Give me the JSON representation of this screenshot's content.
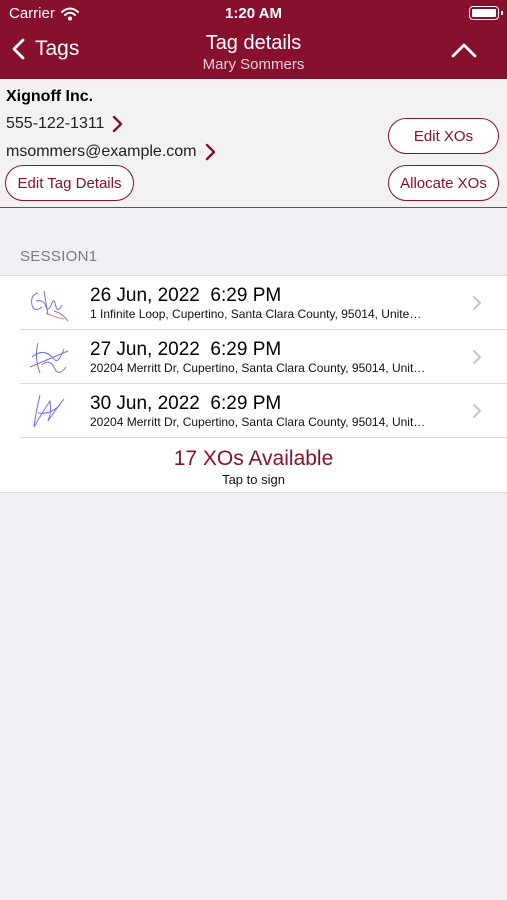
{
  "status_bar": {
    "carrier": "Carrier",
    "time": "1:20 AM"
  },
  "nav": {
    "back_label": "Tags",
    "title": "Tag details",
    "subtitle": "Mary Sommers"
  },
  "contact": {
    "company": "Xignoff Inc.",
    "phone": "555-122-1311",
    "email": "msommers@example.com"
  },
  "buttons": {
    "edit_tag_details": "Edit Tag Details",
    "edit_xos": "Edit XOs",
    "allocate_xos": "Allocate XOs"
  },
  "session": {
    "name": "SESSION1",
    "entries": [
      {
        "date": "26 Jun, 2022  6:29 PM",
        "address": "1 Infinite Loop, Cupertino, Santa Clara County, 95014, Unite…"
      },
      {
        "date": "27 Jun, 2022  6:29 PM",
        "address": "20204 Merritt Dr, Cupertino, Santa Clara County, 95014, Unit…"
      },
      {
        "date": "30 Jun, 2022  6:29 PM",
        "address": "20204 Merritt Dr, Cupertino, Santa Clara County, 95014, Unit…"
      }
    ]
  },
  "available": {
    "title": "17 XOs Available",
    "subtitle": "Tap to sign"
  },
  "colors": {
    "accent": "#87102e",
    "background": "#efeff4",
    "panel": "#f2f2f2"
  }
}
